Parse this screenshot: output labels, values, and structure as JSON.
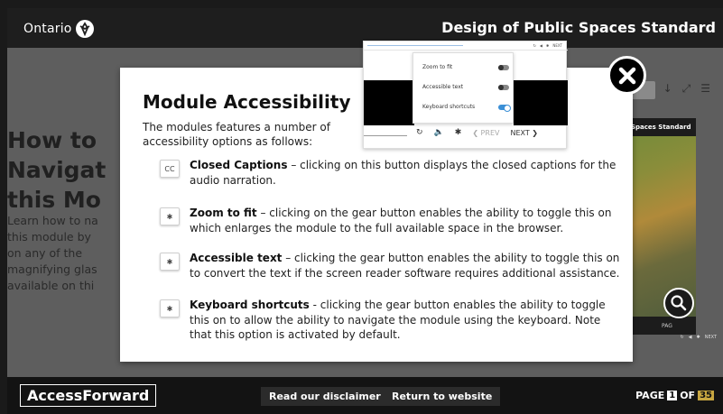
{
  "header": {
    "logo_text": "Ontario",
    "standard_title": "Design of Public Spaces Standard"
  },
  "background": {
    "title_lines": [
      "How to",
      "Navigat",
      "this Mo"
    ],
    "body_lines": [
      "Learn how to na",
      "this module by",
      "on any of the",
      "magnifying glas",
      "available on thi"
    ],
    "photo_caption": "Spaces Standard",
    "photo_page_label": "PAG",
    "mini_next": "NEXT"
  },
  "modal": {
    "title": "Module Accessibility",
    "intro": "The modules features a number of accessibility options as follows:",
    "items": [
      {
        "icon": "cc-icon",
        "icon_text": "CC",
        "label": "Closed Captions",
        "text": " – clicking on this button displays the closed captions for the audio narration."
      },
      {
        "icon": "gear-icon",
        "label": "Zoom to fit",
        "text": " – clicking on the gear button enables the ability to toggle this on which enlarges the module to the full available space in the browser."
      },
      {
        "icon": "gear-icon",
        "label": "Accessible text",
        "text": " – clicking the gear button enables the ability to toggle this on to convert the text if the screen reader software requires additional assistance."
      },
      {
        "icon": "gear-icon",
        "label": "Keyboard shortcuts",
        "text": " - clicking the gear button enables the ability to toggle this on to allow the ability to navigate the module using the keyboard.  Note that this option is activated by default."
      }
    ],
    "preview": {
      "top_next": "NEXT",
      "menu": [
        {
          "label": "Zoom to fit",
          "on": false
        },
        {
          "label": "Accessible text",
          "on": false
        },
        {
          "label": "Keyboard shortcuts",
          "on": true
        }
      ],
      "prev_label": "❮ PREV",
      "next_label": "NEXT ❯"
    }
  },
  "footer": {
    "brand": "AccessForward",
    "disclaimer_label": "Read our disclaimer",
    "return_label": "Return to website",
    "page_label": "PAGE",
    "page_current": "1",
    "page_of": "OF",
    "page_total": "35"
  },
  "colors": {
    "accent_toggle": "#3b8fd6",
    "page_total_bg": "#c8a640"
  }
}
